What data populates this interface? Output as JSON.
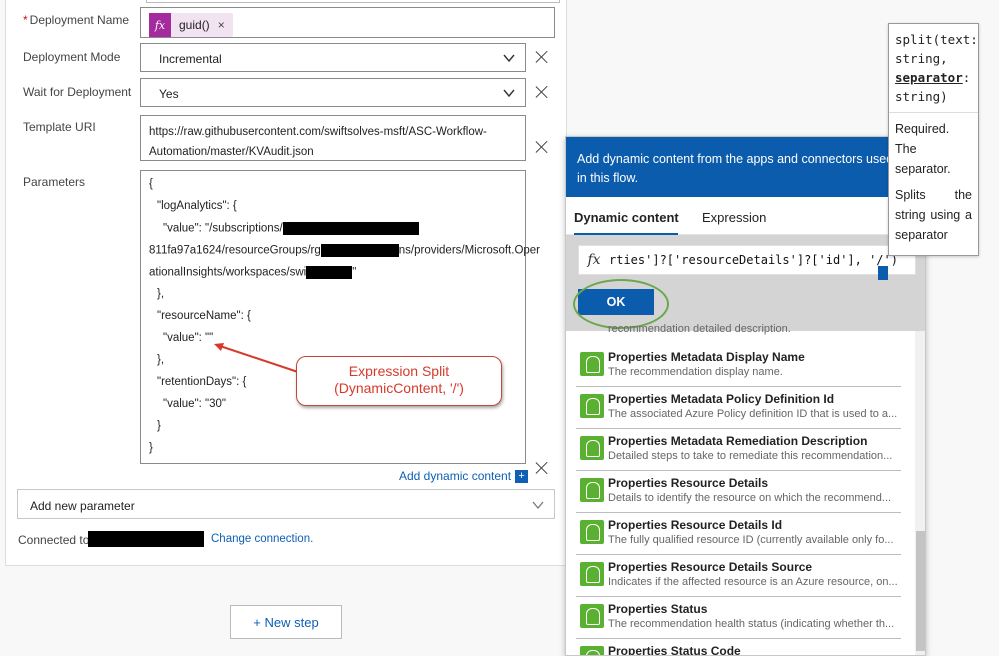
{
  "form": {
    "deployment_name": {
      "label": "Deployment Name",
      "required_mark": "*",
      "token": "guid()",
      "token_remove": "×",
      "fx_label": "fx"
    },
    "deployment_mode": {
      "label": "Deployment Mode",
      "value": "Incremental"
    },
    "wait_for_deployment": {
      "label": "Wait for Deployment",
      "value": "Yes"
    },
    "template_uri": {
      "label": "Template URI",
      "line1": "https://raw.githubusercontent.com/swiftsolves-msft/ASC-Workflow-",
      "line2": "Automation/master/KVAudit.json"
    },
    "parameters": {
      "label": "Parameters",
      "lines": [
        "{",
        "\"logAnalytics\": {",
        "\"value\": \"/subscriptions/",
        "811fa97a1624/resourceGroups/rg",
        "ns/providers/Microsoft.Oper",
        "ationalInsights/workspaces/swi",
        "\"",
        "},",
        "\"resourceName\": {",
        "\"value\": \"\"",
        "},",
        "\"retentionDays\": {",
        "\"value\": \"30\"",
        "}",
        "}"
      ]
    },
    "add_dynamic_content": "Add dynamic content",
    "add_dynamic_plus": "+",
    "add_new_parameter": "Add new parameter",
    "connected_to": "Connected to",
    "change_connection": "Change connection."
  },
  "callout": {
    "line1": "Expression Split",
    "line2": "(DynamicContent, '/')"
  },
  "new_step": "+ New step",
  "dynamic_panel": {
    "header": "Add dynamic content from the apps and connectors used in this flow.",
    "tabs": [
      "Dynamic content",
      "Expression"
    ],
    "expression_text": "rties']?['resourceDetails']?['id'], '/')",
    "expression_fx": "fx",
    "ok_label": "OK",
    "partial_row": "recommendation detailed description.",
    "items": [
      {
        "title": "Properties Metadata Display Name",
        "desc": "The recommendation display name."
      },
      {
        "title": "Properties Metadata Policy Definition Id",
        "desc": "The associated Azure Policy definition ID that is used to a..."
      },
      {
        "title": "Properties Metadata Remediation Description",
        "desc": "Detailed steps to take to remediate this recommendation..."
      },
      {
        "title": "Properties Resource Details",
        "desc": "Details to identify the resource on which the recommend..."
      },
      {
        "title": "Properties Resource Details Id",
        "desc": "The fully qualified resource ID (currently available only fo..."
      },
      {
        "title": "Properties Resource Details Source",
        "desc": "Indicates if the affected resource is an Azure resource, on..."
      },
      {
        "title": "Properties Status",
        "desc": "The recommendation health status (indicating whether th..."
      },
      {
        "title": "Properties Status Code",
        "desc": ""
      }
    ]
  },
  "tooltip": {
    "sig_prefix": "split(text: string,",
    "sig_param": "separator",
    "sig_suffix": ": string)",
    "required": "Required. The separator.",
    "desc": "Splits the string using a separator"
  },
  "colors": {
    "accent": "#0b5cad",
    "fx_purple": "#a42a9e",
    "callout_red": "#d53a2c",
    "highlight_green": "#6aa84f",
    "item_icon_green": "#5ab031"
  }
}
